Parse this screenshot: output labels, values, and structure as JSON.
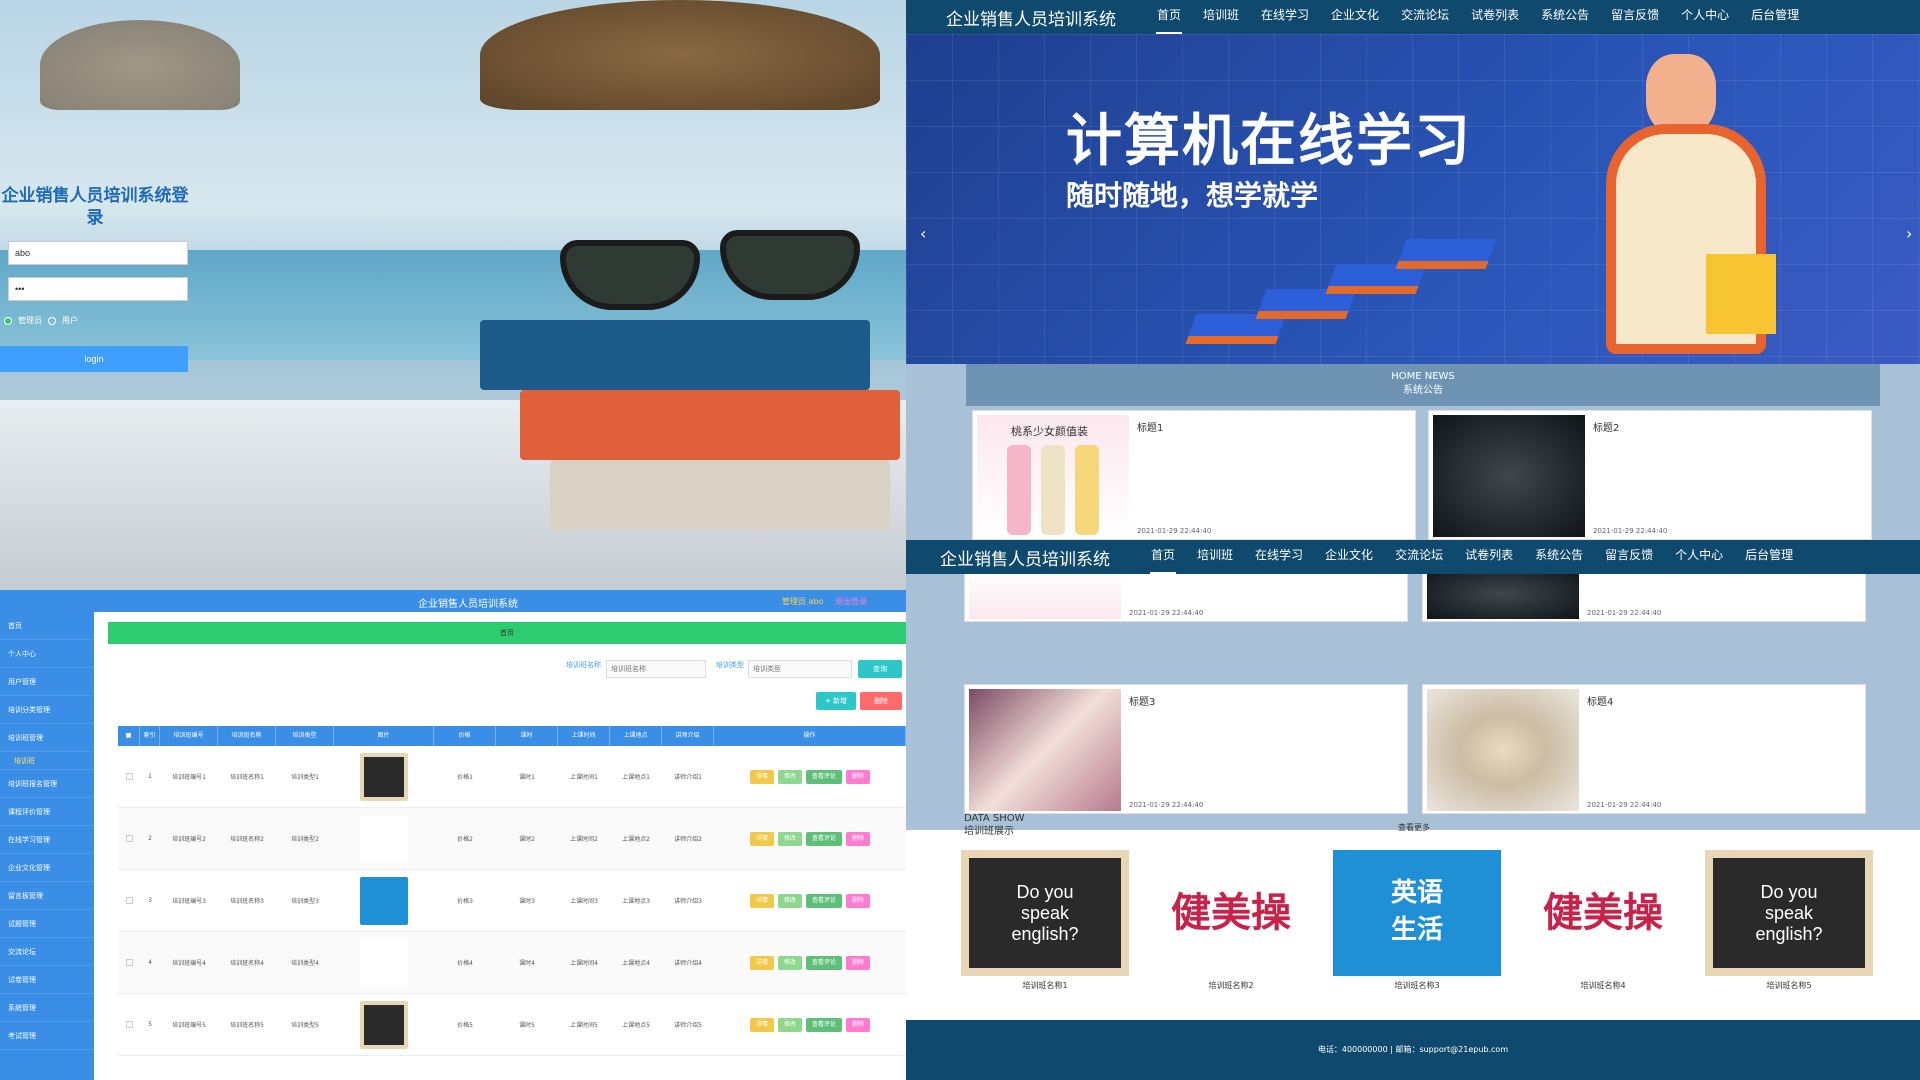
{
  "login": {
    "title": "企业销售人员培训系统登录",
    "username": "abo",
    "password": "•••",
    "role_admin": "管理员",
    "role_user": "用户",
    "login_button": "login"
  },
  "home": {
    "brand": "企业销售人员培训系统",
    "nav": [
      "首页",
      "培训班",
      "在线学习",
      "企业文化",
      "交流论坛",
      "试卷列表",
      "系统公告",
      "留言反馈",
      "个人中心",
      "后台管理"
    ],
    "banner": {
      "title": "计算机在线学习",
      "subtitle": "随时随地，想学就学"
    },
    "news": {
      "en": "HOME NEWS",
      "cn": "系统公告",
      "items": [
        {
          "title": "标题1",
          "date": "2021-01-29 22:44:40",
          "img_text": "桃系少女颜值装"
        },
        {
          "title": "标题2",
          "date": "2021-01-29 22:44:40"
        },
        {
          "title": "标题3",
          "date": "2021-01-29 22:44:40"
        },
        {
          "title": "标题4",
          "date": "2021-01-29 22:44:40"
        }
      ]
    },
    "more": "查看更多",
    "data_show": {
      "en": "DATA SHOW",
      "cn": "培训班展示",
      "items": [
        "培训班名称1",
        "培训班名称2",
        "培训班名称3",
        "培训班名称4",
        "培训班名称5"
      ]
    },
    "footer": "电话：400000000 | 邮箱：support@21epub.com"
  },
  "admin": {
    "title": "企业销售人员培训系统",
    "user": "管理员 abo",
    "user2": "退出登录",
    "sidebar": [
      "首页",
      "个人中心",
      "用户管理",
      "培训分类管理",
      "培训班管理",
      "培训班",
      "培训班报名管理",
      "课程评价管理",
      "在线学习管理",
      "企业文化管理",
      "留言板管理",
      "试题管理",
      "交流论坛",
      "试卷管理",
      "系统管理",
      "考试管理"
    ],
    "crumb": "首页",
    "search": {
      "label1": "培训班名称",
      "placeholder1": "培训班名称",
      "label2": "培训类型",
      "placeholder2": "培训类型",
      "search_button": "查询"
    },
    "add_button": "+ 新增",
    "delete_button": "删除",
    "columns": [
      "索引",
      "培训班编号",
      "培训班名称",
      "培训类型",
      "图片",
      "价格",
      "课时",
      "上课时间",
      "上课地点",
      "讲师介绍",
      "操作"
    ],
    "rows": [
      {
        "i": "1",
        "no": "培训班编号1",
        "name": "培训班名称1",
        "type": "培训类型1",
        "price": "价格1",
        "hours": "课时1",
        "time": "上课时间1",
        "place": "上课地点1",
        "intro": "讲师介绍1"
      },
      {
        "i": "2",
        "no": "培训班编号2",
        "name": "培训班名称2",
        "type": "培训类型2",
        "price": "价格2",
        "hours": "课时2",
        "time": "上课时间2",
        "place": "上课地点2",
        "intro": "讲师介绍2"
      },
      {
        "i": "3",
        "no": "培训班编号3",
        "name": "培训班名称3",
        "type": "培训类型3",
        "price": "价格3",
        "hours": "课时3",
        "time": "上课时间3",
        "place": "上课地点3",
        "intro": "讲师介绍3"
      },
      {
        "i": "4",
        "no": "培训班编号4",
        "name": "培训班名称4",
        "type": "培训类型4",
        "price": "价格4",
        "hours": "课时4",
        "time": "上课时间4",
        "place": "上课地点4",
        "intro": "讲师介绍4"
      },
      {
        "i": "5",
        "no": "培训班编号5",
        "name": "培训班名称5",
        "type": "培训类型5",
        "price": "价格5",
        "hours": "课时5",
        "time": "上课时间5",
        "place": "上课地点5",
        "intro": "讲师介绍5"
      }
    ],
    "ops": {
      "detail": "详情",
      "edit": "修改",
      "review": "查看评论",
      "delete": "删除"
    }
  },
  "colors": {
    "nav": "#0f4a6e",
    "admin_blue": "#3a8ee6",
    "green": "#2ecc71",
    "banner": "#2a56b8"
  }
}
